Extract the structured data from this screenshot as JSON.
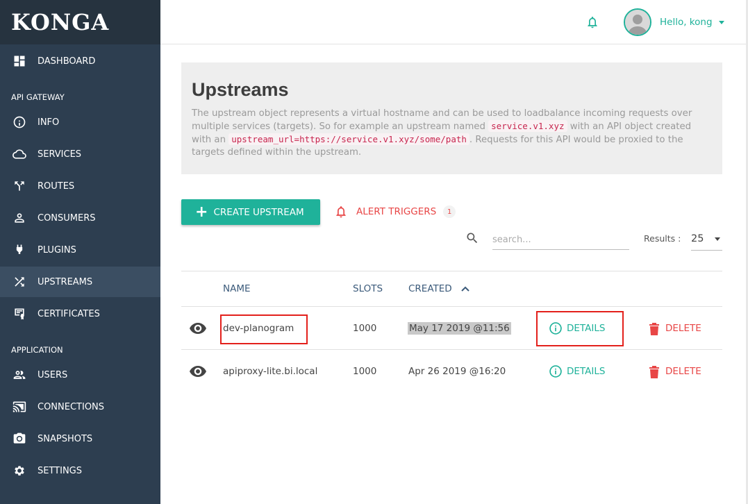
{
  "app": {
    "logo": "KONGA"
  },
  "sidebar": {
    "items": [
      {
        "label": "DASHBOARD",
        "icon": "dashboard-icon"
      },
      {
        "label": "INFO",
        "icon": "info-icon"
      },
      {
        "label": "SERVICES",
        "icon": "cloud-icon"
      },
      {
        "label": "ROUTES",
        "icon": "routes-icon"
      },
      {
        "label": "CONSUMERS",
        "icon": "person-icon"
      },
      {
        "label": "PLUGINS",
        "icon": "plug-icon"
      },
      {
        "label": "UPSTREAMS",
        "icon": "shuffle-icon"
      },
      {
        "label": "CERTIFICATES",
        "icon": "certificate-icon"
      },
      {
        "label": "USERS",
        "icon": "users-icon"
      },
      {
        "label": "CONNECTIONS",
        "icon": "cast-icon"
      },
      {
        "label": "SNAPSHOTS",
        "icon": "camera-icon"
      },
      {
        "label": "SETTINGS",
        "icon": "gear-icon"
      }
    ],
    "sections": {
      "api_gateway": "API GATEWAY",
      "application": "APPLICATION"
    }
  },
  "header": {
    "greeting": "Hello, kong"
  },
  "page": {
    "title": "Upstreams",
    "description_1": "The upstream object represents a virtual hostname and can be used to loadbalance incoming requests over multiple services (targets). So for example an upstream named ",
    "code_1": "service.v1.xyz",
    "description_2": " with an API object created with an ",
    "code_2": "upstream_url=https://service.v1.xyz/some/path",
    "description_3": ". Requests for this API would be proxied to the targets defined within the upstream."
  },
  "actions": {
    "create_label": "CREATE UPSTREAM",
    "alert_label": "ALERT TRIGGERS",
    "alert_count": "1"
  },
  "search": {
    "placeholder": "search..."
  },
  "results": {
    "label": "Results :",
    "value": "25"
  },
  "table": {
    "headers": {
      "name": "NAME",
      "slots": "SLOTS",
      "created": "CREATED"
    },
    "rows": [
      {
        "name": "dev-planogram",
        "slots": "1000",
        "created": "May 17 2019 @11:56",
        "details": "DETAILS",
        "delete": "DELETE"
      },
      {
        "name": "apiproxy-lite.bi.local",
        "slots": "1000",
        "created": "Apr 26 2019 @16:20",
        "details": "DETAILS",
        "delete": "DELETE"
      }
    ]
  },
  "colors": {
    "accent": "#1fb29a",
    "danger": "#e84646",
    "sidebar": "#2d3e50"
  }
}
